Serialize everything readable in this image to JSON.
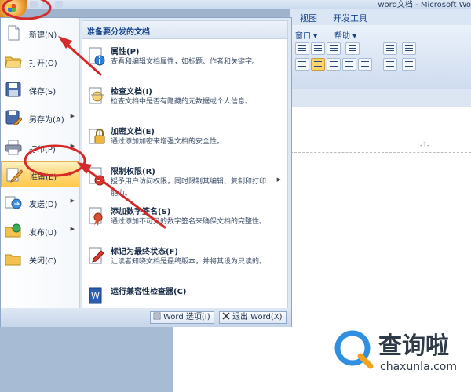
{
  "window": {
    "title": "word文档 - Microsoft Wo"
  },
  "ribbon": {
    "tabs": [
      "视图",
      "开发工具"
    ],
    "window_group": "窗口",
    "help_group": "帮助"
  },
  "ruler": {
    "page_number": "-1-"
  },
  "office_menu": {
    "left_items": [
      {
        "label": "新建(N)",
        "icon": "new-document-icon"
      },
      {
        "label": "打开(O)",
        "icon": "open-folder-icon"
      },
      {
        "label": "保存(S)",
        "icon": "save-disk-icon"
      },
      {
        "label": "另存为(A)",
        "icon": "save-as-icon"
      },
      {
        "label": "打印(P)",
        "icon": "printer-icon"
      },
      {
        "label": "准备(E)",
        "icon": "prepare-icon"
      },
      {
        "label": "发送(D)",
        "icon": "send-icon"
      },
      {
        "label": "发布(U)",
        "icon": "publish-icon"
      },
      {
        "label": "关闭(C)",
        "icon": "close-folder-icon"
      }
    ],
    "highlighted_item": "准备(E)",
    "right_panel": {
      "title": "准备要分发的文档",
      "items": [
        {
          "title": "属性(P)",
          "desc": "查看和编辑文档属性，如标题、作者和关键字。",
          "icon": "properties-icon"
        },
        {
          "title": "检查文档(I)",
          "desc": "检查文档中是否有隐藏的元数据或个人信息。",
          "icon": "inspect-document-icon"
        },
        {
          "title": "加密文档(E)",
          "desc": "通过添加加密来增强文档的安全性。",
          "icon": "encrypt-lock-icon"
        },
        {
          "title": "限制权限(R)",
          "desc": "授予用户访问权限，同时限制其编辑、复制和打印能力。",
          "icon": "restrict-permission-icon"
        },
        {
          "title": "添加数字签名(S)",
          "desc": "通过添加不可见的数字签名来确保文档的完整性。",
          "icon": "digital-signature-icon"
        },
        {
          "title": "标记为最终状态(F)",
          "desc": "让读者知晓文档是最终版本，并将其设为只读的。",
          "icon": "mark-final-icon"
        },
        {
          "title": "运行兼容性检查器(C)",
          "desc": "",
          "icon": "compatibility-checker-icon"
        }
      ]
    },
    "bottom_buttons": {
      "options": "Word 选项(I)",
      "exit": "退出 Word(X)"
    }
  },
  "watermark": {
    "text": "查询啦",
    "url": "chaxunla.com"
  },
  "colors": {
    "highlight": "#ffd77a",
    "annotation": "#d42a2a",
    "menu_bg": "#dde8f5"
  }
}
